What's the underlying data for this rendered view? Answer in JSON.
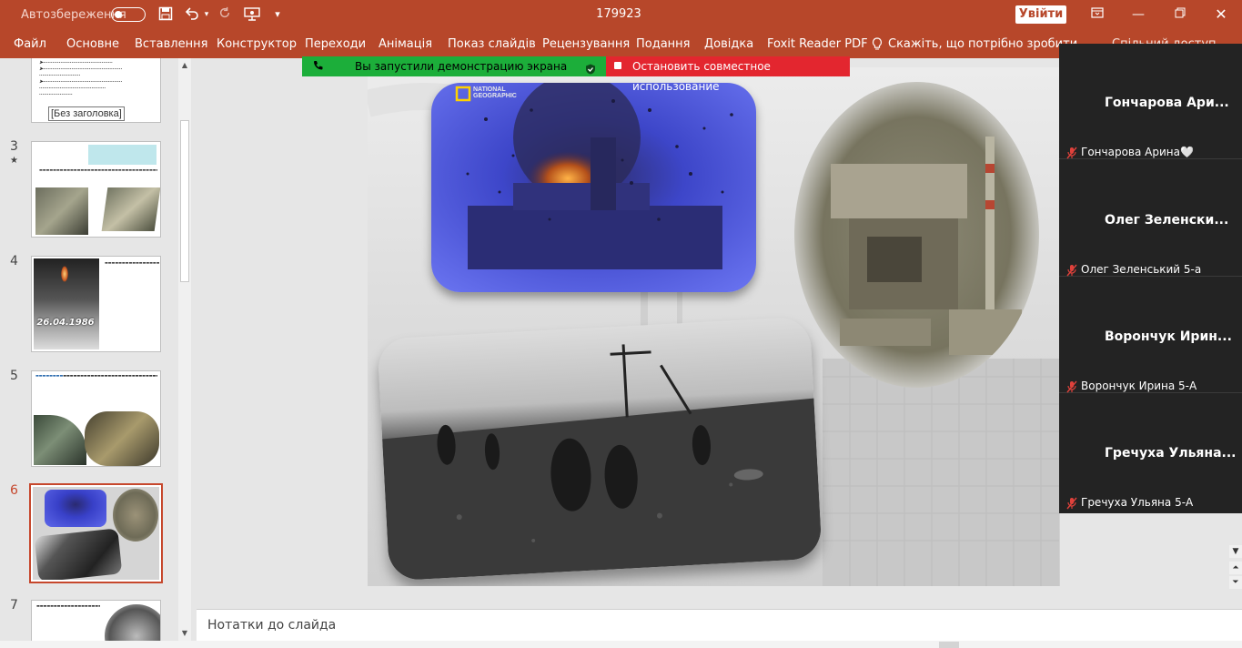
{
  "titlebar": {
    "autosave_label": "Автозбереження",
    "doc_title": "179923",
    "login_label": "Увійти",
    "quick_access": [
      "save-icon",
      "undo-icon",
      "redo-icon",
      "slideshow-icon",
      "customize-icon"
    ]
  },
  "ribbon": {
    "tabs": [
      "Файл",
      "Основне",
      "Вставлення",
      "Конструктор",
      "Переходи",
      "Анімація",
      "Показ слайдів",
      "Рецензування",
      "Подання",
      "Довідка",
      "Foxit Reader PDF"
    ],
    "tell_me": "Скажіть, що потрібно зробити",
    "share": "Спільний доступ"
  },
  "share_bar": {
    "sharing_text": "Вы запустили демонстрацию экрана",
    "stop_text": "Остановить совместное использование"
  },
  "slides": [
    {
      "num": "",
      "tooltip": "[Без заголовка]"
    },
    {
      "num": "3"
    },
    {
      "num": "4"
    },
    {
      "num": "5"
    },
    {
      "num": "6"
    },
    {
      "num": "7"
    }
  ],
  "slide_texts": {
    "thumb4_date": "26.04.1986",
    "main_logo_line1": "NATIONAL",
    "main_logo_line2": "GEOGRAPHIC"
  },
  "notes": {
    "placeholder": "Нотатки до слайда"
  },
  "participants": [
    {
      "big_name": "Гончарова Ари...",
      "small_name": "Гончарова Арина🤍"
    },
    {
      "big_name": "Олег Зеленски...",
      "small_name": "Олег Зеленський 5-а"
    },
    {
      "big_name": "Ворончук Ирин...",
      "small_name": "Ворончук Ирина 5-А"
    },
    {
      "big_name": "Гречуха Ульяна...",
      "small_name": "Гречуха Ульяна 5-А"
    }
  ],
  "colors": {
    "accent": "#b7472a",
    "share_green": "#1cae3a",
    "share_red": "#e3262f",
    "active_slide_border": "#c6472c"
  }
}
